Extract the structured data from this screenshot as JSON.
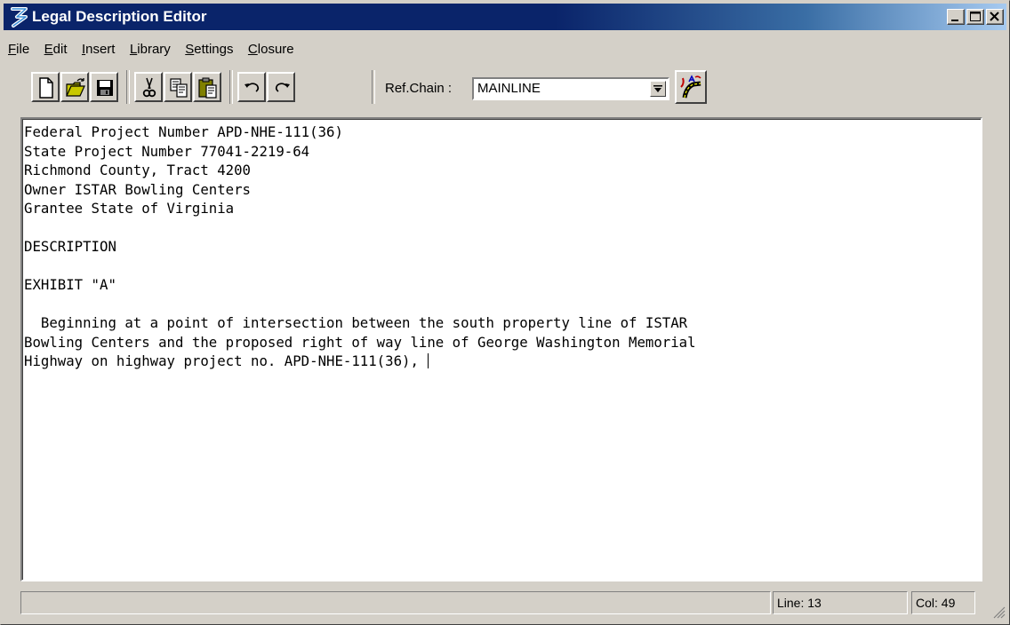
{
  "window": {
    "title": "Legal Description Editor"
  },
  "menu": [
    {
      "pre": "",
      "key": "F",
      "post": "ile"
    },
    {
      "pre": "",
      "key": "E",
      "post": "dit"
    },
    {
      "pre": "",
      "key": "I",
      "post": "nsert"
    },
    {
      "pre": "",
      "key": "L",
      "post": "ibrary"
    },
    {
      "pre": "",
      "key": "S",
      "post": "ettings"
    },
    {
      "pre": "",
      "key": "C",
      "post": "losure"
    }
  ],
  "toolbar": {
    "buttons": [
      "new-icon",
      "open-icon",
      "save-icon",
      "cut-icon",
      "copy-icon",
      "paste-icon",
      "undo-icon",
      "redo-icon"
    ],
    "refchain_label": "Ref.Chain :",
    "refchain_value": "MAINLINE",
    "alignment_button_icon": "alignment-icon"
  },
  "editor": {
    "lines": [
      "Federal Project Number APD-NHE-111(36)",
      "State Project Number 77041-2219-64",
      "Richmond County, Tract 4200",
      "Owner ISTAR Bowling Centers",
      "Grantee State of Virginia",
      "",
      "DESCRIPTION",
      "",
      "EXHIBIT \"A\"",
      "",
      "  Beginning at a point of intersection between the south property line of ISTAR",
      "Bowling Centers and the proposed right of way line of George Washington Memorial",
      "Highway on highway project no. APD-NHE-111(36), "
    ]
  },
  "status": {
    "message": "",
    "line": "Line: 13",
    "col": "Col: 49"
  },
  "colors": {
    "titlebar": "#0a246a",
    "face": "#d4d0c8"
  }
}
